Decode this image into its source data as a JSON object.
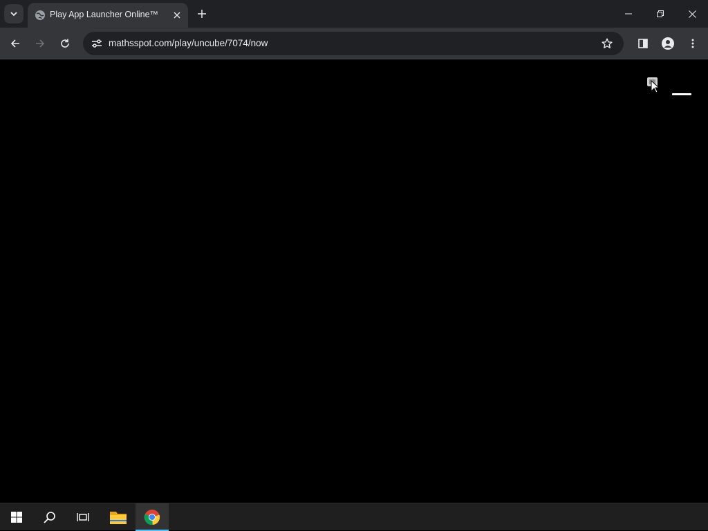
{
  "browser": {
    "tab": {
      "title": "Play App Launcher Online™",
      "favicon": "globe-icon"
    },
    "address_bar": {
      "url": "mathsspot.com/play/uncube/7074/now"
    },
    "icons": {
      "tab_search": "chevron-down-icon",
      "close_tab": "close-icon",
      "new_tab": "plus-icon",
      "back": "arrow-left-icon",
      "forward": "arrow-right-icon",
      "reload": "reload-icon",
      "site_info": "tune-icon",
      "bookmark": "star-icon",
      "side_panel": "side-panel-icon",
      "profile": "person-icon",
      "more": "more-vertical-icon"
    },
    "window_controls": [
      "minimize-icon",
      "restore-icon",
      "close-icon"
    ]
  },
  "page": {
    "background": "#000000",
    "controls": [
      "game-icon",
      "hamburger-menu-button"
    ]
  },
  "taskbar": {
    "items": [
      "windows-start-icon",
      "search-icon",
      "task-view-icon",
      "file-explorer-icon",
      "chrome-icon"
    ],
    "active": "chrome-icon",
    "accent": "#4cc2ff"
  }
}
